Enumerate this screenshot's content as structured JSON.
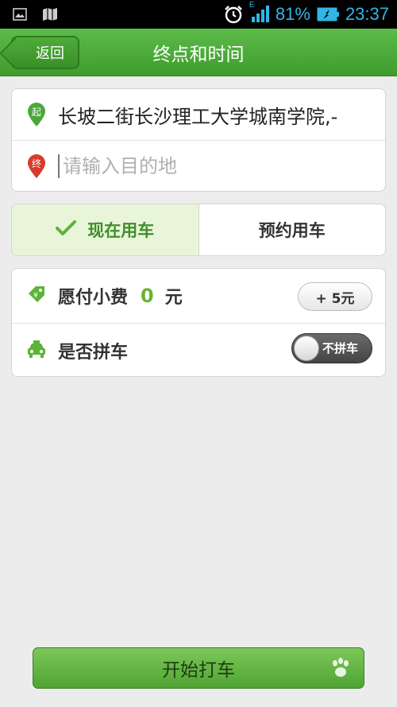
{
  "status_bar": {
    "network_type": "E",
    "battery": "81%",
    "time": "23:37"
  },
  "header": {
    "back_label": "返回",
    "title": "终点和时间"
  },
  "route": {
    "start_badge": "起",
    "start_address": "长坡二街长沙理工大学城南学院,-",
    "end_badge": "终",
    "end_placeholder": "请输入目的地"
  },
  "mode_tabs": {
    "now_label": "现在用车",
    "reserve_label": "预约用车"
  },
  "options": {
    "tip_label": "愿付小费",
    "tip_value": "0",
    "tip_unit": "元",
    "tip_add_label": "+ 5元",
    "carpool_label": "是否拼车",
    "carpool_toggle_label": "不拼车"
  },
  "footer": {
    "start_label": "开始打车"
  },
  "colors": {
    "brand_green": "#4aa83a",
    "active_tab_bg": "#e9f5d8",
    "tip_value": "#6bb32e",
    "end_pin": "#d93a2b"
  }
}
